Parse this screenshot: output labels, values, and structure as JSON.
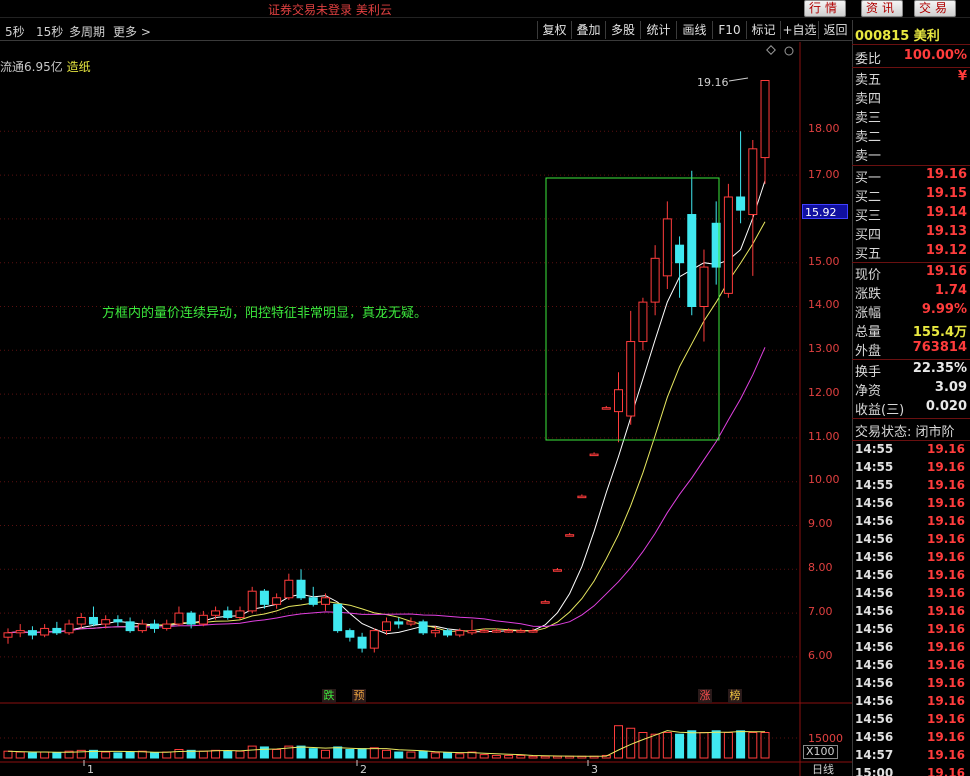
{
  "title_bar": {
    "text": "证券交易未登录  美利云",
    "buttons": [
      "行情",
      "资讯",
      "交易"
    ]
  },
  "toolbar": {
    "left_items": [
      "5秒",
      "15秒",
      "多周期",
      "更多 >"
    ],
    "right_buttons": [
      "复权",
      "叠加",
      "多股",
      "统计",
      "画线",
      "F10",
      "标记",
      "+自选",
      "返回"
    ]
  },
  "info": {
    "prefix": "流通6.95亿",
    "tag": "造纸"
  },
  "annotation": "方框内的量价连续异动，阳控特征非常明显，真龙无疑。",
  "price_axis": {
    "labels": [
      "18.00",
      "17.00",
      "16.00",
      "15.00",
      "14.00",
      "13.00",
      "12.00",
      "11.00",
      "10.00",
      "9.00",
      "8.00",
      "7.00",
      "6.00"
    ],
    "current": "15.92",
    "high_label": "19.16"
  },
  "markers": [
    {
      "text": "跌",
      "color": "#3ce83c"
    },
    {
      "text": "预",
      "color": "#e8a040"
    },
    {
      "text": "涨",
      "color": "#ff5050"
    },
    {
      "text": "榜",
      "color": "#e8c040"
    }
  ],
  "volume": {
    "label": "15000",
    "multiplier": "X100"
  },
  "period_label": "日线",
  "date_ticks": [
    "1",
    "2",
    "3"
  ],
  "chart_data": {
    "type": "candlestick",
    "ylim": [
      5.8,
      19.4
    ],
    "candles": [
      {
        "o": 6.45,
        "c": 6.55,
        "h": 6.65,
        "l": 6.3,
        "v": 8
      },
      {
        "o": 6.55,
        "c": 6.6,
        "h": 6.75,
        "l": 6.45,
        "v": 7
      },
      {
        "o": 6.6,
        "c": 6.5,
        "h": 6.7,
        "l": 6.4,
        "v": 6
      },
      {
        "o": 6.5,
        "c": 6.65,
        "h": 6.75,
        "l": 6.45,
        "v": 7
      },
      {
        "o": 6.65,
        "c": 6.55,
        "h": 6.8,
        "l": 6.5,
        "v": 6
      },
      {
        "o": 6.55,
        "c": 6.75,
        "h": 6.85,
        "l": 6.5,
        "v": 8
      },
      {
        "o": 6.75,
        "c": 6.9,
        "h": 7.0,
        "l": 6.65,
        "v": 9
      },
      {
        "o": 6.9,
        "c": 6.75,
        "h": 7.15,
        "l": 6.7,
        "v": 9
      },
      {
        "o": 6.75,
        "c": 6.85,
        "h": 6.95,
        "l": 6.65,
        "v": 7
      },
      {
        "o": 6.85,
        "c": 6.8,
        "h": 6.95,
        "l": 6.7,
        "v": 6
      },
      {
        "o": 6.8,
        "c": 6.6,
        "h": 6.9,
        "l": 6.55,
        "v": 7
      },
      {
        "o": 6.6,
        "c": 6.75,
        "h": 6.85,
        "l": 6.55,
        "v": 8
      },
      {
        "o": 6.75,
        "c": 6.65,
        "h": 6.85,
        "l": 6.55,
        "v": 6
      },
      {
        "o": 6.65,
        "c": 6.75,
        "h": 6.85,
        "l": 6.6,
        "v": 7
      },
      {
        "o": 6.75,
        "c": 7.0,
        "h": 7.15,
        "l": 6.7,
        "v": 10
      },
      {
        "o": 7.0,
        "c": 6.75,
        "h": 7.05,
        "l": 6.65,
        "v": 9
      },
      {
        "o": 6.75,
        "c": 6.95,
        "h": 7.05,
        "l": 6.7,
        "v": 8
      },
      {
        "o": 6.95,
        "c": 7.05,
        "h": 7.15,
        "l": 6.85,
        "v": 9
      },
      {
        "o": 7.05,
        "c": 6.9,
        "h": 7.15,
        "l": 6.85,
        "v": 8
      },
      {
        "o": 6.9,
        "c": 7.05,
        "h": 7.15,
        "l": 6.85,
        "v": 8
      },
      {
        "o": 7.05,
        "c": 7.5,
        "h": 7.6,
        "l": 7.0,
        "v": 14
      },
      {
        "o": 7.5,
        "c": 7.2,
        "h": 7.55,
        "l": 7.1,
        "v": 13
      },
      {
        "o": 7.2,
        "c": 7.35,
        "h": 7.45,
        "l": 7.1,
        "v": 10
      },
      {
        "o": 7.35,
        "c": 7.75,
        "h": 7.9,
        "l": 7.3,
        "v": 14
      },
      {
        "o": 7.75,
        "c": 7.35,
        "h": 8.0,
        "l": 7.3,
        "v": 14
      },
      {
        "o": 7.35,
        "c": 7.2,
        "h": 7.6,
        "l": 7.15,
        "v": 11
      },
      {
        "o": 7.2,
        "c": 7.35,
        "h": 7.45,
        "l": 7.05,
        "v": 9
      },
      {
        "o": 7.2,
        "c": 6.6,
        "h": 7.2,
        "l": 6.55,
        "v": 13
      },
      {
        "o": 6.6,
        "c": 6.45,
        "h": 6.65,
        "l": 6.35,
        "v": 10
      },
      {
        "o": 6.45,
        "c": 6.2,
        "h": 6.55,
        "l": 6.1,
        "v": 11
      },
      {
        "o": 6.2,
        "c": 6.6,
        "h": 6.65,
        "l": 6.1,
        "v": 12
      },
      {
        "o": 6.6,
        "c": 6.8,
        "h": 6.9,
        "l": 6.5,
        "v": 9
      },
      {
        "o": 6.8,
        "c": 6.75,
        "h": 6.9,
        "l": 6.65,
        "v": 7
      },
      {
        "o": 6.75,
        "c": 6.8,
        "h": 6.9,
        "l": 6.7,
        "v": 7
      },
      {
        "o": 6.8,
        "c": 6.55,
        "h": 6.85,
        "l": 6.5,
        "v": 8
      },
      {
        "o": 6.55,
        "c": 6.6,
        "h": 6.7,
        "l": 6.45,
        "v": 6
      },
      {
        "o": 6.6,
        "c": 6.5,
        "h": 6.65,
        "l": 6.45,
        "v": 6
      },
      {
        "o": 6.5,
        "c": 6.6,
        "h": 6.65,
        "l": 6.45,
        "v": 5
      },
      {
        "o": 6.55,
        "c": 6.6,
        "h": 6.85,
        "l": 6.5,
        "v": 7
      },
      {
        "o": 6.6,
        "c": 6.6,
        "h": 6.65,
        "l": 6.55,
        "v": 4
      },
      {
        "o": 6.6,
        "c": 6.6,
        "h": 6.65,
        "l": 6.55,
        "v": 3
      },
      {
        "o": 6.6,
        "c": 6.6,
        "h": 6.65,
        "l": 6.55,
        "v": 3
      },
      {
        "o": 6.6,
        "c": 6.6,
        "h": 6.65,
        "l": 6.55,
        "v": 3
      },
      {
        "o": 6.6,
        "c": 6.6,
        "h": 6.65,
        "l": 6.55,
        "v": 2
      },
      {
        "o": 7.26,
        "c": 7.26,
        "h": 7.3,
        "l": 7.22,
        "v": 2
      },
      {
        "o": 7.99,
        "c": 7.99,
        "h": 8.03,
        "l": 7.95,
        "v": 2
      },
      {
        "o": 8.79,
        "c": 8.79,
        "h": 8.83,
        "l": 8.75,
        "v": 2
      },
      {
        "o": 9.67,
        "c": 9.67,
        "h": 9.71,
        "l": 9.63,
        "v": 2
      },
      {
        "o": 10.63,
        "c": 10.63,
        "h": 10.67,
        "l": 10.59,
        "v": 2
      },
      {
        "o": 11.69,
        "c": 11.69,
        "h": 11.73,
        "l": 11.65,
        "v": 3
      },
      {
        "o": 11.6,
        "c": 12.1,
        "h": 12.5,
        "l": 10.9,
        "v": 38
      },
      {
        "o": 11.5,
        "c": 13.2,
        "h": 13.9,
        "l": 11.3,
        "v": 35
      },
      {
        "o": 13.2,
        "c": 14.1,
        "h": 14.2,
        "l": 13.0,
        "v": 30
      },
      {
        "o": 14.1,
        "c": 15.1,
        "h": 15.4,
        "l": 13.8,
        "v": 28
      },
      {
        "o": 14.7,
        "c": 16.0,
        "h": 16.4,
        "l": 14.4,
        "v": 30
      },
      {
        "o": 15.4,
        "c": 15.0,
        "h": 15.6,
        "l": 14.2,
        "v": 28
      },
      {
        "o": 16.1,
        "c": 14.0,
        "h": 17.1,
        "l": 13.8,
        "v": 32
      },
      {
        "o": 14.0,
        "c": 14.9,
        "h": 15.3,
        "l": 13.2,
        "v": 30
      },
      {
        "o": 15.9,
        "c": 14.9,
        "h": 16.4,
        "l": 14.5,
        "v": 32
      },
      {
        "o": 14.3,
        "c": 16.5,
        "h": 16.8,
        "l": 14.2,
        "v": 30
      },
      {
        "o": 16.5,
        "c": 16.2,
        "h": 18.0,
        "l": 15.9,
        "v": 32
      },
      {
        "o": 16.1,
        "c": 17.6,
        "h": 17.8,
        "l": 14.7,
        "v": 30
      },
      {
        "o": 17.4,
        "c": 19.16,
        "h": 19.16,
        "l": 16.8,
        "v": 30
      }
    ]
  },
  "panel": {
    "code": "000815 美利",
    "weibi": {
      "k": "委比",
      "v": "100.00%"
    },
    "sells": [
      {
        "k": "卖五",
        "v": "¥"
      },
      {
        "k": "卖四",
        "v": ""
      },
      {
        "k": "卖三",
        "v": ""
      },
      {
        "k": "卖二",
        "v": ""
      },
      {
        "k": "卖一",
        "v": ""
      }
    ],
    "buys": [
      {
        "k": "买一",
        "v": "19.16"
      },
      {
        "k": "买二",
        "v": "19.15"
      },
      {
        "k": "买三",
        "v": "19.14"
      },
      {
        "k": "买四",
        "v": "19.13"
      },
      {
        "k": "买五",
        "v": "19.12"
      }
    ],
    "stats": [
      {
        "k": "现价",
        "v": "19.16",
        "c": "red"
      },
      {
        "k": "涨跌",
        "v": "1.74",
        "c": "red"
      },
      {
        "k": "涨幅",
        "v": "9.99%",
        "c": "red"
      },
      {
        "k": "总量",
        "v": "155.4万",
        "c": "yel"
      },
      {
        "k": "外盘",
        "v": "763814",
        "c": "red"
      }
    ],
    "stats2": [
      {
        "k": "换手",
        "v": "22.35%",
        "c": "wht"
      },
      {
        "k": "净资",
        "v": "3.09",
        "c": "wht"
      },
      {
        "k": "收益(三)",
        "v": "0.020",
        "c": "wht"
      }
    ],
    "trade_status": "交易状态: 闭市阶",
    "ticks": [
      {
        "t": "14:55",
        "p": "19.16"
      },
      {
        "t": "14:55",
        "p": "19.16"
      },
      {
        "t": "14:55",
        "p": "19.16"
      },
      {
        "t": "14:56",
        "p": "19.16"
      },
      {
        "t": "14:56",
        "p": "19.16"
      },
      {
        "t": "14:56",
        "p": "19.16"
      },
      {
        "t": "14:56",
        "p": "19.16"
      },
      {
        "t": "14:56",
        "p": "19.16"
      },
      {
        "t": "14:56",
        "p": "19.16"
      },
      {
        "t": "14:56",
        "p": "19.16"
      },
      {
        "t": "14:56",
        "p": "19.16"
      },
      {
        "t": "14:56",
        "p": "19.16"
      },
      {
        "t": "14:56",
        "p": "19.16"
      },
      {
        "t": "14:56",
        "p": "19.16"
      },
      {
        "t": "14:56",
        "p": "19.16"
      },
      {
        "t": "14:56",
        "p": "19.16"
      },
      {
        "t": "14:56",
        "p": "19.16"
      },
      {
        "t": "14:57",
        "p": "19.16"
      },
      {
        "t": "15:00",
        "p": "19.16"
      }
    ]
  }
}
